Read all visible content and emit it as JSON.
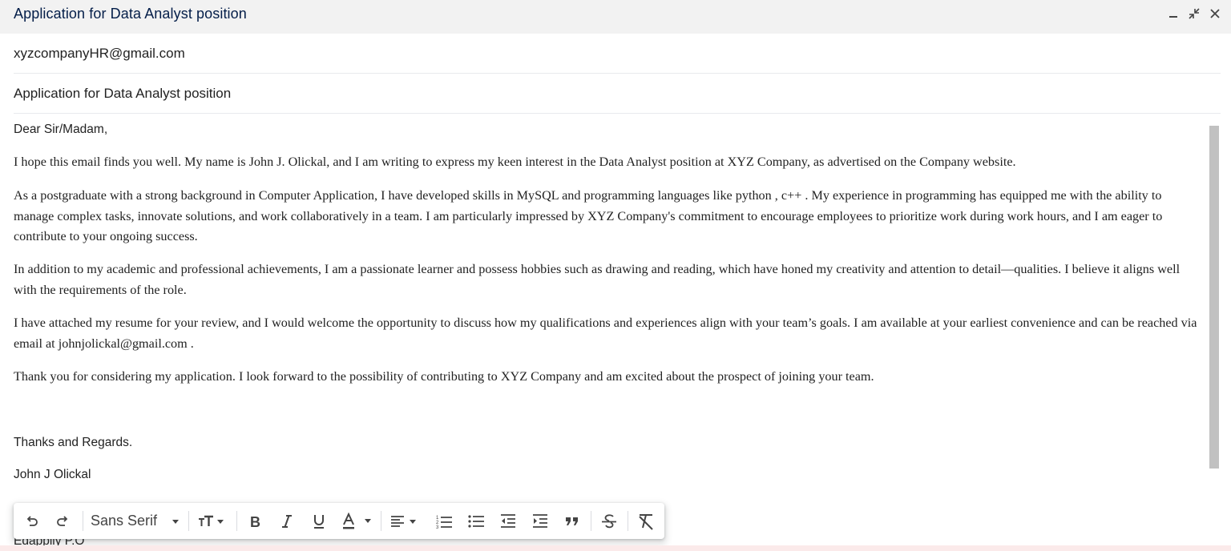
{
  "window": {
    "title": "Application for Data Analyst position",
    "minimize_icon": "minimize-icon",
    "exit_fullscreen_icon": "exit-fullscreen-icon",
    "close_icon": "close-icon"
  },
  "compose": {
    "to": "xyzcompanyHR@gmail.com",
    "subject": "Application for Data Analyst position"
  },
  "body": {
    "greeting": "Dear Sir/Madam,",
    "paragraphs": [
      "I hope this email finds you well. My name is John J. Olickal, and I am writing to express my keen interest in the Data Analyst  position at XYZ Company, as advertised on the Company website.",
      "As a postgraduate with a strong background in Computer Application, I have developed skills in MySQL and programming languages like python , c++ . My experience in programming  has equipped me with the ability to  manage complex tasks, innovate solutions,  and work collaboratively in a team. I am particularly impressed by XYZ Company's commitment to encourage employees to prioritize work during work hours, and I am eager to contribute to your ongoing success.",
      "In addition to my academic and professional achievements, I am a passionate learner and possess hobbies such as drawing and reading, which have honed my creativity and attention to detail—qualities. I believe it aligns well with the requirements of the role.",
      "I have attached my resume for your review, and I would welcome the opportunity to discuss how my qualifications and experiences align with your team’s goals. I am available at your earliest convenience and can be reached via email at johnjolickal@gmail.com .",
      "Thank you for considering my application. I look forward to the possibility of contributing to XYZ Company and am excited about the prospect of joining your team."
    ],
    "closing": "Thanks and Regards.",
    "signature": "John J Olickal",
    "address_partial": "Edappily P.O"
  },
  "toolbar": {
    "font_family": "Sans Serif",
    "buttons": [
      "undo-icon",
      "redo-icon",
      "text-size-icon",
      "bold-icon",
      "italic-icon",
      "underline-icon",
      "text-color-icon",
      "align-icon",
      "numbered-list-icon",
      "bulleted-list-icon",
      "indent-less-icon",
      "indent-more-icon",
      "quote-icon",
      "strikethrough-icon",
      "remove-formatting-icon"
    ]
  },
  "colors": {
    "title_bar_bg": "#f2f2f2",
    "title_text": "#041e49",
    "scrollbar_thumb": "#c1c1c1"
  }
}
